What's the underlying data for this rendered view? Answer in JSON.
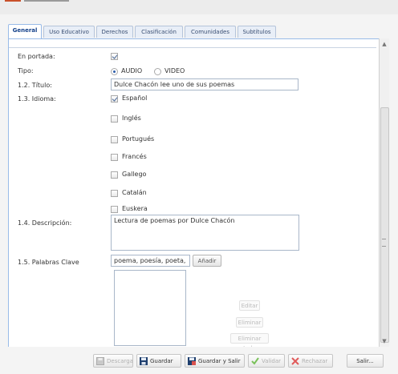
{
  "tabs": [
    {
      "label": "General",
      "active": true
    },
    {
      "label": "Uso Educativo",
      "active": false
    },
    {
      "label": "Derechos",
      "active": false
    },
    {
      "label": "Clasificación",
      "active": false
    },
    {
      "label": "Comunidades",
      "active": false
    },
    {
      "label": "Subtítulos",
      "active": false
    }
  ],
  "form": {
    "portada_label": "En portada:",
    "portada_checked": true,
    "tipo_label": "Tipo:",
    "tipo_options": [
      "AUDIO",
      "VIDEO"
    ],
    "tipo_selected": "AUDIO",
    "titulo_label": "1.2. Título:",
    "titulo_value": "Dulce Chacón lee uno de sus poemas",
    "idioma_label": "1.3. Idioma:",
    "idiomas": [
      {
        "label": "Español",
        "checked": true
      },
      {
        "label": "Inglés",
        "checked": false
      },
      {
        "label": "Portugués",
        "checked": false
      },
      {
        "label": "Francés",
        "checked": false
      },
      {
        "label": "Gallego",
        "checked": false
      },
      {
        "label": "Catalán",
        "checked": false
      },
      {
        "label": "Euskera",
        "checked": false
      }
    ],
    "descripcion_label": "1.4. Descripción:",
    "descripcion_value": "Lectura de poemas por Dulce Chacón",
    "palabras_label": "1.5. Palabras Clave",
    "palabras_value": "poema, poesía, poeta,",
    "anadir_label": "Añadir",
    "editar_label": "Editar",
    "eliminar_label": "Eliminar",
    "eliminar_todo_label": "Eliminar todo"
  },
  "footer": {
    "descargar": "Descargar",
    "guardar": "Guardar",
    "guardar_salir": "Guardar y Salir",
    "validar": "Validar",
    "rechazar": "Rechazar",
    "salir": "Salir..."
  },
  "colors": {
    "accent": "#15428b",
    "tab_border": "#99bbe8",
    "save_icon": "#1f3f6e",
    "validate_icon": "#7ac15a",
    "reject_icon": "#e05a5a"
  }
}
